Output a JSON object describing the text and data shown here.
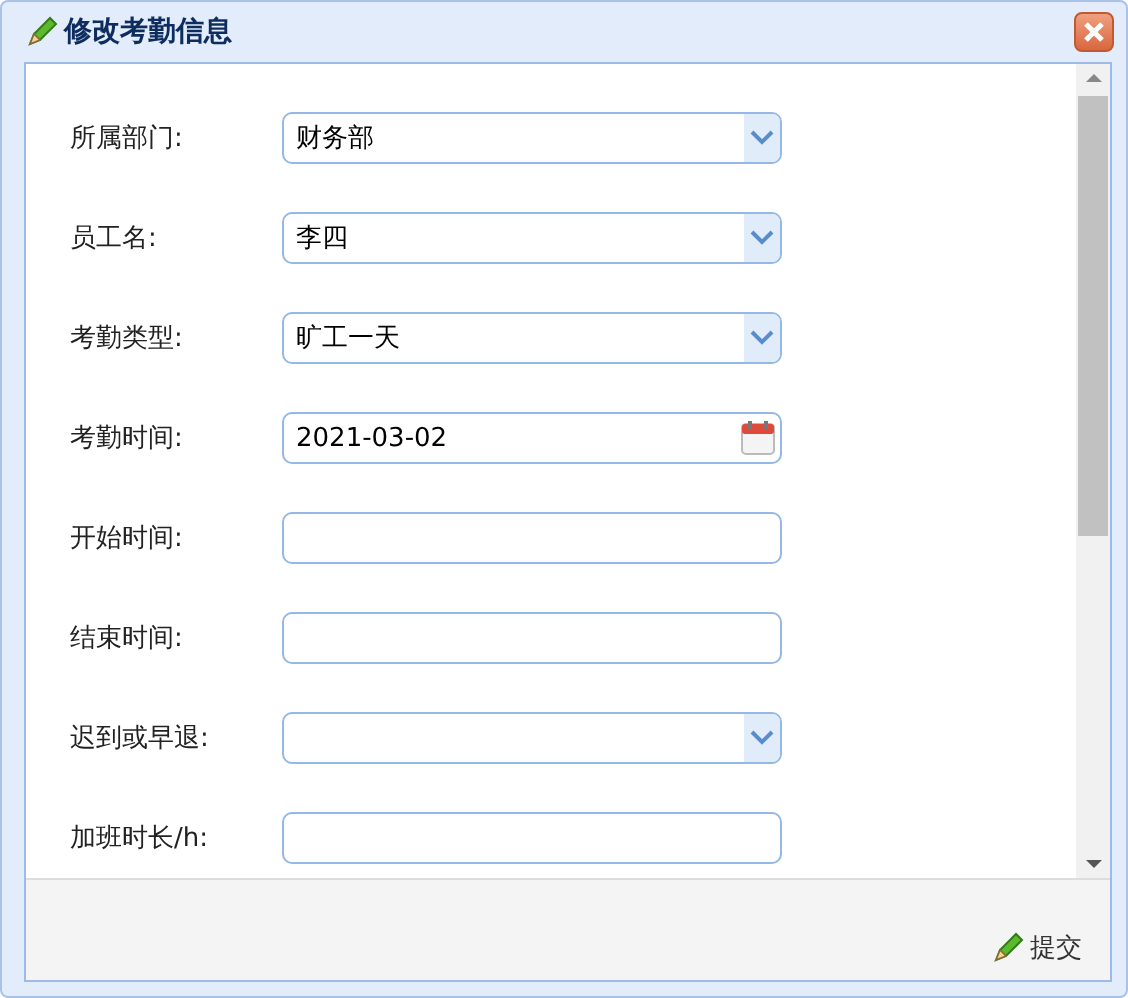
{
  "window": {
    "title": "修改考勤信息"
  },
  "fields": [
    {
      "label": "所属部门:",
      "kind": "select",
      "value": "财务部"
    },
    {
      "label": "员工名:",
      "kind": "select",
      "value": "李四"
    },
    {
      "label": "考勤类型:",
      "kind": "select",
      "value": "旷工一天"
    },
    {
      "label": "考勤时间:",
      "kind": "date",
      "value": "2021-03-02"
    },
    {
      "label": "开始时间:",
      "kind": "text"
    },
    {
      "label": "结束时间:",
      "kind": "text"
    },
    {
      "label": "迟到或早退:",
      "kind": "select"
    },
    {
      "label": "加班时长/h:",
      "kind": "text"
    }
  ],
  "buttons": [
    {
      "label": "提交"
    }
  ]
}
